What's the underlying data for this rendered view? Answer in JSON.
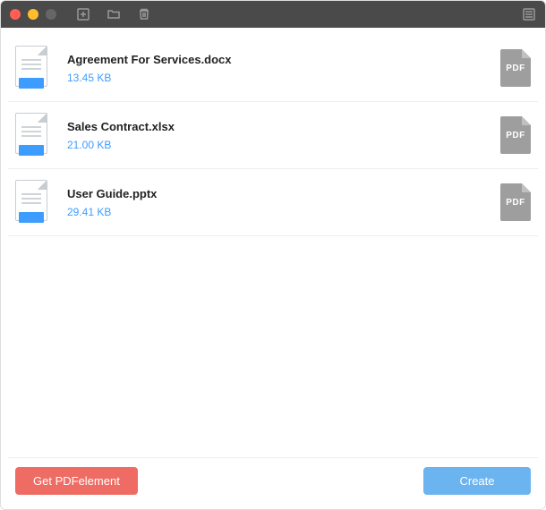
{
  "files": [
    {
      "name": "Agreement For Services.docx",
      "size": "13.45 KB",
      "badge": "PDF"
    },
    {
      "name": "Sales Contract.xlsx",
      "size": "21.00 KB",
      "badge": "PDF"
    },
    {
      "name": "User Guide.pptx",
      "size": "29.41 KB",
      "badge": "PDF"
    }
  ],
  "footer": {
    "get_pdfelement": "Get PDFelement",
    "create": "Create"
  }
}
